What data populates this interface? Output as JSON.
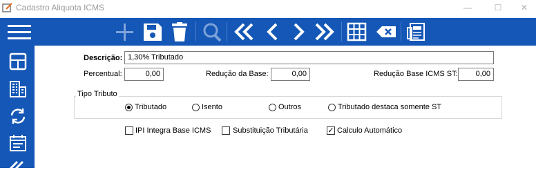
{
  "window": {
    "title": "Cadastro Aliquota ICMS",
    "minimize": "—",
    "maximize": "☐",
    "close": "✕"
  },
  "colors": {
    "toolbar": "#1557b6",
    "icon": "#ffffff",
    "icon_disabled": "#7fa3d9"
  },
  "toolbar": {
    "icons": [
      "menu-icon",
      "add-icon",
      "save-icon",
      "delete-icon",
      "search-icon",
      "first-icon",
      "previous-icon",
      "next-icon",
      "last-icon",
      "grid-icon",
      "clear-icon",
      "report-icon"
    ]
  },
  "sidebar": {
    "icons": [
      "layout-icon",
      "building-icon",
      "sync-icon",
      "calendar-list-icon",
      "collapse-icon"
    ]
  },
  "form": {
    "descricao_label": "Descrição:",
    "descricao_value": "1,30% Tributado",
    "percentual_label": "Percentual:",
    "percentual_value": "0,00",
    "reducao_base_label": "Redução da Base:",
    "reducao_base_value": "0,00",
    "reducao_base_st_label": "Redução Base ICMS ST:",
    "reducao_base_st_value": "0,00",
    "tipo_tributo_label": "Tipo Tributo",
    "tipo_tributo_options": [
      "Tributado",
      "Isento",
      "Outros",
      "Tributado destaca somente ST"
    ],
    "tipo_tributo_selected": "Tributado",
    "checkboxes": [
      {
        "label": "IPI Integra Base ICMS",
        "checked": false
      },
      {
        "label": "Substituição Tributária",
        "checked": false
      },
      {
        "label": "Calculo Automático",
        "checked": true
      }
    ]
  }
}
